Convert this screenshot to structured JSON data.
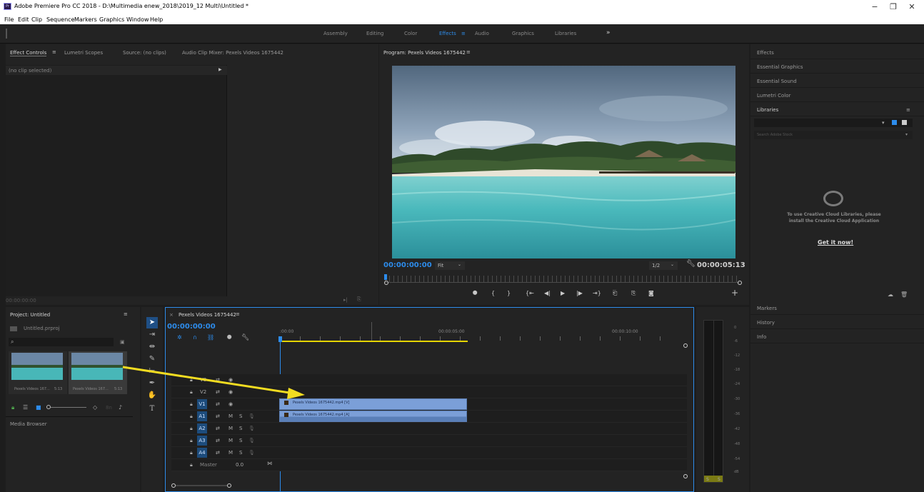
{
  "window": {
    "title": "Adobe Premiere Pro CC 2018 - D:\\Multimedia enew_2018\\2019_12 Multi\\Untitled *",
    "app_icon": "Pr",
    "minimize": "−",
    "maximize": "❐",
    "close": "✕"
  },
  "menu": [
    "File",
    "Edit",
    "Clip",
    "Sequence",
    "Markers",
    "Graphics",
    "Window",
    "Help"
  ],
  "workspaces": {
    "items": [
      "Assembly",
      "Editing",
      "Color",
      "Effects",
      "Audio",
      "Graphics",
      "Libraries"
    ],
    "active": "Effects",
    "more": "»"
  },
  "source_panel": {
    "tabs": [
      "Effect Controls",
      "Lumetri Scopes",
      "Source: (no clips)",
      "Audio Clip Mixer: Pexels Videos 1675442"
    ],
    "no_clip": "(no clip selected)",
    "timecode": "00:00:00:00"
  },
  "program": {
    "title": "Program: Pexels Videos 1675442",
    "timecode": "00:00:00:00",
    "fit": "Fit",
    "resolution": "1/2",
    "duration": "00:00:05:13"
  },
  "right_panel": {
    "items": [
      "Effects",
      "Essential Graphics",
      "Essential Sound",
      "Lumetri Color"
    ],
    "libraries": "Libraries",
    "search_placeholder": "Search Adobe Stock",
    "cc_message": "To use Creative Cloud Libraries, please install the Creative Cloud Application",
    "cc_link": "Get it now!",
    "bottom_items": [
      "Markers",
      "History",
      "Info"
    ]
  },
  "project": {
    "title": "Project: Untitled",
    "file": "Untitled.prproj",
    "clips": [
      {
        "name": "Pexels Videos 167...",
        "dur": "5:13"
      },
      {
        "name": "Pexels Videos 167...",
        "dur": "5:13"
      }
    ],
    "items_count": "8n",
    "media_browser": "Media Browser"
  },
  "timeline": {
    "tab": "Pexels Videos 1675442",
    "timecode": "00:00:00:00",
    "ruler": [
      ":00:00",
      "00:00:05:00",
      "00:00:10:00"
    ],
    "video_tracks": [
      "V3",
      "V2",
      "V1"
    ],
    "audio_tracks": [
      "A1",
      "A2",
      "A3",
      "A4"
    ],
    "master": "Master",
    "master_val": "0.0",
    "video_clip": "Pexels Videos 1675442.mp4 [V]",
    "audio_clip": "Pexels Videos 1675442.mp4 [A]",
    "m": "M",
    "s": "S"
  },
  "meter": {
    "labels": [
      "0",
      "-6",
      "-12",
      "-18",
      "-24",
      "-30",
      "-36",
      "-42",
      "-48",
      "-54",
      "dB"
    ],
    "solo": "S"
  },
  "colors": {
    "accent": "#2d8ceb",
    "clip": "#7b9fd8",
    "arrow": "#f2dc21"
  }
}
